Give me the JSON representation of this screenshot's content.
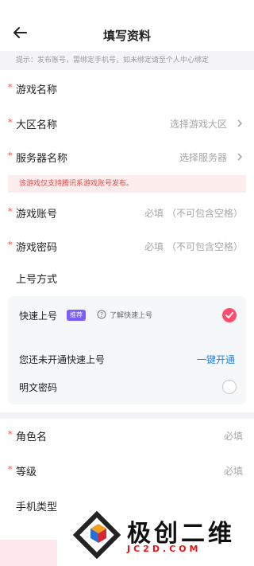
{
  "header": {
    "title": "填写资料"
  },
  "hint": "提示：发布账号，需绑定手机号，如未绑定请至个人中心绑定",
  "fields": {
    "game_name": {
      "required": "*",
      "label": "游戏名称"
    },
    "region": {
      "required": "*",
      "label": "大区名称",
      "value": "选择游戏大区"
    },
    "server": {
      "required": "*",
      "label": "服务器名称",
      "value": "选择服务器"
    },
    "warning": "该游戏仅支持腾讯系游戏账号发布。",
    "account": {
      "required": "*",
      "label": "游戏账号",
      "placeholder": "必填 （不可包含空格）"
    },
    "password": {
      "required": "*",
      "label": "游戏密码",
      "placeholder": "必填 （不可包含空格）"
    },
    "login_method": {
      "label": "上号方式"
    }
  },
  "login_card": {
    "quick_label": "快速上号",
    "quick_badge": "推荐",
    "quick_help": "了解快速上号",
    "not_enabled": "您还未开通快速上号",
    "enable_link": "一键开通",
    "plain_label": "明文密码"
  },
  "role": {
    "name": {
      "required": "*",
      "label": "角色名",
      "placeholder": "必填"
    },
    "level": {
      "required": "*",
      "label": "等级",
      "placeholder": "必填"
    },
    "phone_type": {
      "label": "手机类型"
    }
  },
  "watermark": {
    "name": "极创二维",
    "domain": "JC2D.COM"
  },
  "colors": {
    "accent": "#ff4b6e",
    "link": "#2a82e4",
    "required": "#e84c3d",
    "badge": "#7b5cff"
  }
}
